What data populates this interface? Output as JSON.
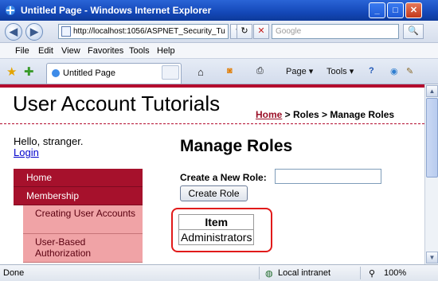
{
  "window": {
    "title": "Untitled Page - Windows Internet Explorer",
    "min": "_",
    "max": "□",
    "close": "✕"
  },
  "address": {
    "url": "http://localhost:1056/ASPNET_Security_Tu",
    "search_placeholder": "Google",
    "back": "◀",
    "forward": "▶",
    "refresh": "↻",
    "stop": "✕",
    "go": "▾",
    "search": "🔍"
  },
  "menubar": {
    "items": [
      "File",
      "Edit",
      "View",
      "Favorites",
      "Tools",
      "Help"
    ]
  },
  "tabbar": {
    "tab_label": "Untitled Page",
    "page_label": "Page ▾",
    "tools_label": "Tools ▾",
    "help_label": "?"
  },
  "site": {
    "title": "User Account Tutorials",
    "breadcrumb_home": "Home",
    "breadcrumb_rest": " > Roles > Manage Roles",
    "hello": "Hello, stranger.",
    "login": "Login",
    "menu": [
      {
        "label": "Home",
        "level": 1
      },
      {
        "label": "Membership",
        "level": 1
      },
      {
        "label": "Creating User Accounts",
        "level": 2
      },
      {
        "label": "User-Based Authorization",
        "level": 2
      }
    ],
    "heading": "Manage Roles",
    "create_label": "Create a New Role:",
    "create_button": "Create Role",
    "table_header": "Item",
    "table_rows": [
      "Administrators"
    ]
  },
  "status": {
    "left": "Done",
    "zone": "Local intranet",
    "zoom": "100%"
  },
  "colors": {
    "accent": "#a6112c",
    "highlight": "#e11a1a",
    "titlebar": "#1448b8"
  }
}
